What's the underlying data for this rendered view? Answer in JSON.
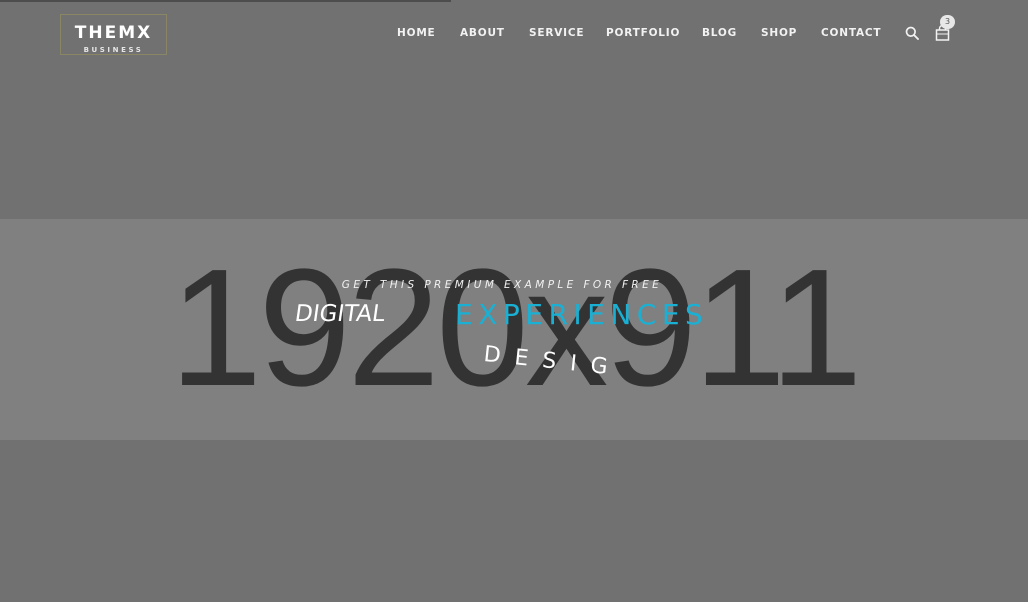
{
  "header": {
    "logo": {
      "main": "THEMX",
      "sub": "BUSINESS"
    },
    "nav": [
      {
        "label": "HOME"
      },
      {
        "label": "ABOUT"
      },
      {
        "label": "SERVICE"
      },
      {
        "label": "PORTFOLIO"
      },
      {
        "label": "BLOG"
      },
      {
        "label": "SHOP"
      },
      {
        "label": "CONTACT"
      }
    ],
    "icons": {
      "search": "search-icon",
      "cart": "shopping-bag-icon"
    },
    "cart_count": "3"
  },
  "hero": {
    "placeholder_text": "1920x911",
    "subtitle": "GET THIS PREMIUM EXAMPLE FOR FREE",
    "word1": "DIGITAL",
    "word2": "EXPERIENCES",
    "word3": "DESIG",
    "accent_color": "#1ab0d4",
    "background": "#808080"
  }
}
